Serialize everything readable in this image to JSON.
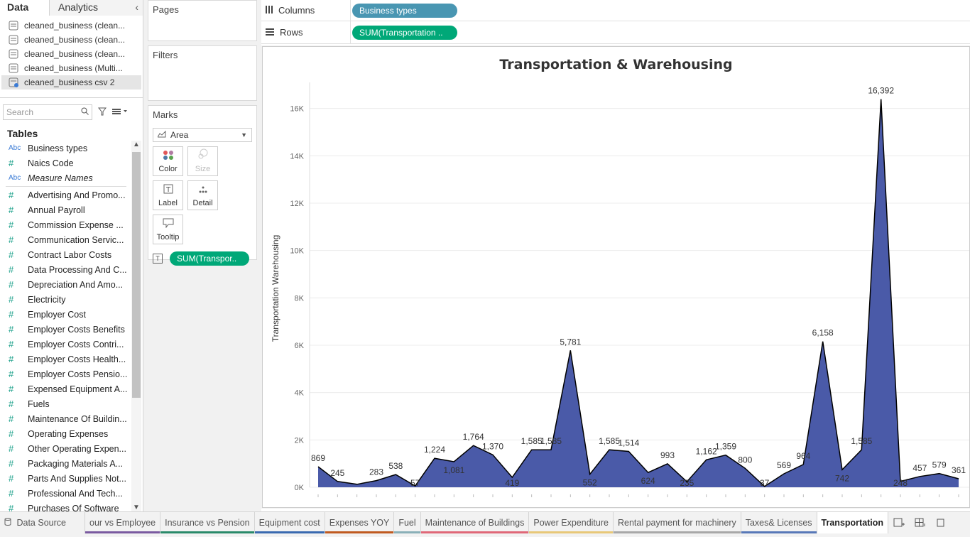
{
  "data_pane": {
    "tab_data": "Data",
    "tab_analytics": "Analytics",
    "sources": [
      "cleaned_business (clean...",
      "cleaned_business (clean...",
      "cleaned_business (clean...",
      "cleaned_business (Multi...",
      "cleaned_business csv 2"
    ],
    "search_placeholder": "Search",
    "tables_heading": "Tables",
    "dimensions": [
      {
        "type": "Abc",
        "label": "Business types"
      },
      {
        "type": "#",
        "label": "Naics Code"
      },
      {
        "type": "Abc",
        "label": "Measure Names"
      }
    ],
    "measures": [
      "Advertising And Promo...",
      "Annual Payroll",
      "Commission Expense ...",
      "Communication Servic...",
      "Contract Labor Costs",
      "Data Processing And C...",
      "Depreciation And Amo...",
      "Electricity",
      "Employer Cost",
      "Employer Costs Benefits",
      "Employer Costs Contri...",
      "Employer Costs Health...",
      "Employer Costs Pensio...",
      "Expensed Equipment A...",
      "Fuels",
      "Maintenance Of Buildin...",
      "Operating Expenses",
      "Other Operating Expen...",
      "Packaging Materials A...",
      "Parts And Supplies Not...",
      "Professional And Tech...",
      "Purchases Of Software"
    ]
  },
  "cards": {
    "pages": "Pages",
    "filters": "Filters",
    "marks": "Marks",
    "mark_type": "Area",
    "buttons": {
      "color": "Color",
      "size": "Size",
      "label": "Label",
      "detail": "Detail",
      "tooltip": "Tooltip"
    },
    "label_pill": "SUM(Transpor..",
    "label_pill_glyph": "T"
  },
  "shelves": {
    "columns_label": "Columns",
    "columns_pill": "Business types",
    "rows_label": "Rows",
    "rows_pill": "SUM(Transportation .."
  },
  "chart_data": {
    "type": "area",
    "title": "Transportation &  Warehousing",
    "ylabel": "Transportation  Warehousing",
    "xlabel": "",
    "ylim": [
      0,
      16800
    ],
    "yticks": [
      0,
      2000,
      4000,
      6000,
      8000,
      10000,
      12000,
      14000,
      16000
    ],
    "ytick_labels": [
      "0K",
      "2K",
      "4K",
      "6K",
      "8K",
      "10K",
      "12K",
      "14K",
      "16K"
    ],
    "values": [
      869,
      245,
      125,
      283,
      538,
      57,
      1224,
      1081,
      1764,
      1370,
      419,
      1585,
      1585,
      5781,
      552,
      1585,
      1514,
      624,
      993,
      235,
      1162,
      1359,
      800,
      37,
      569,
      964,
      6158,
      742,
      1585,
      16392,
      248,
      457,
      579,
      361
    ],
    "data_labels": [
      "869",
      "245",
      "",
      "283",
      "538",
      "57",
      "1,224",
      "1,081",
      "1,764",
      "1,370",
      "419",
      "1,585",
      "1,585",
      "5,781",
      "552",
      "1,585",
      "1,514",
      "624",
      "993",
      "235",
      "1,162",
      "1,359",
      "800",
      "37",
      "569",
      "964",
      "6,158",
      "742",
      "1,585",
      "16,392",
      "248",
      "457",
      "579",
      "361"
    ],
    "fill_color": "#4a5aa8",
    "line_color": "#000000",
    "grid": true
  },
  "sheet_tabs": {
    "data_source": "Data Source",
    "sheets": [
      {
        "label": "our vs Employee",
        "color": "#7a5aa0",
        "active": false
      },
      {
        "label": "Insurance  vs  Pension",
        "color": "#2a8a6a",
        "active": false
      },
      {
        "label": "Equipment cost",
        "color": "#3a6ab0",
        "active": false
      },
      {
        "label": "Expenses  YOY",
        "color": "#c05a20",
        "active": false
      },
      {
        "label": "Fuel",
        "color": "#8ab0b8",
        "active": false
      },
      {
        "label": "Maintenance of Buildings",
        "color": "#e06878",
        "active": false
      },
      {
        "label": "Power  Expenditure",
        "color": "#e8c878",
        "active": false
      },
      {
        "label": "Rental payment for machinery",
        "color": "#a8a8a8",
        "active": false
      },
      {
        "label": "Taxes& Licenses",
        "color": "#5878b8",
        "active": false
      },
      {
        "label": "Transportation",
        "color": "#ffffff",
        "active": true
      }
    ]
  }
}
